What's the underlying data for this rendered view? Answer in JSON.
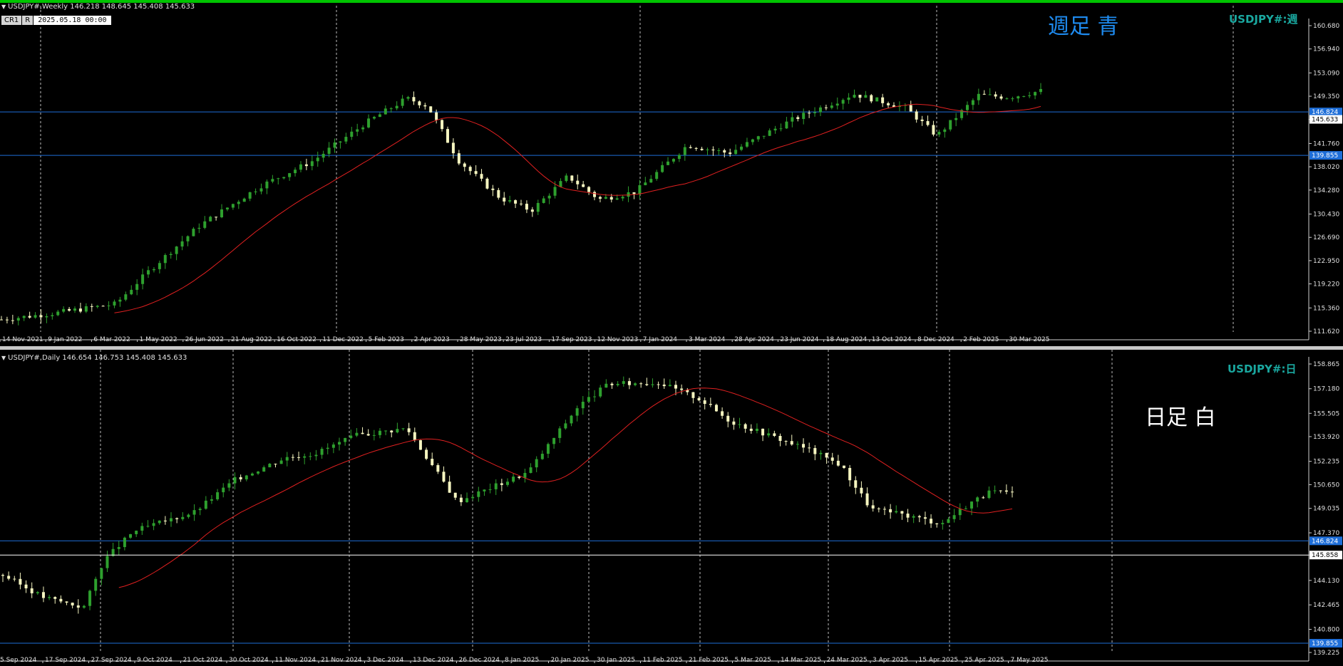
{
  "colors": {
    "background": "#000000",
    "grid": "#cfcfcf",
    "up": "#2ea02e",
    "down": "#f5f5c0",
    "ma": "#e02020",
    "zigzag": "#f0b000",
    "hline": "#1e6ed8",
    "price_tag": "#1e6ed8",
    "symbol_label": "#1aa8a0",
    "weekly_note": "#1e8bf0",
    "daily_note": "#ffffff"
  },
  "weekly": {
    "header": "USDJPY#,Weekly  146.218 148.645 145.408 145.633",
    "toolbar": {
      "btn1": "CR1",
      "btn2": "R",
      "date": "2025.05.18 00:00"
    },
    "note": "週足  青",
    "symbol_label": "USDJPY#:週",
    "yticks": [
      "160.680",
      "156.940",
      "153.090",
      "149.350",
      "145.633",
      "141.760",
      "138.020",
      "134.280",
      "130.430",
      "126.690",
      "122.950",
      "119.220",
      "115.360",
      "111.620"
    ],
    "xticks": [
      "14 Nov 2021",
      "9 Jan 2022",
      "6 Mar 2022",
      "1 May 2022",
      "26 Jun 2022",
      "21 Aug 2022",
      "16 Oct 2022",
      "11 Dec 2022",
      "5 Feb 2023",
      "2 Apr 2023",
      "28 May 2023",
      "23 Jul 2023",
      "17 Sep 2023",
      "12 Nov 2023",
      "7 Jan 2024",
      "3 Mar 2024",
      "28 Apr 2024",
      "23 Jun 2024",
      "18 Aug 2024",
      "13 Oct 2024",
      "8 Dec 2024",
      "2 Feb 2025",
      "30 Mar 2025"
    ],
    "hlines": [
      "146.824",
      "139.855"
    ],
    "current": "145.633"
  },
  "daily": {
    "header": "USDJPY#,Daily  146.654 146.753 145.408 145.633",
    "note": "日足  白",
    "symbol_label": "USDJPY#:日",
    "yticks": [
      "158.865",
      "157.180",
      "155.505",
      "153.920",
      "152.235",
      "150.650",
      "149.035",
      "147.370",
      "145.858",
      "144.130",
      "142.465",
      "140.800",
      "139.225"
    ],
    "xticks": [
      "17 Sep 2024",
      "27 Sep 2024",
      "9 Oct 2024",
      "21 Oct 2024",
      "30 Oct 2024",
      "11 Nov 2024",
      "21 Nov 2024",
      "3 Dec 2024",
      "13 Dec 2024",
      "26 Dec 2024",
      "8 Jan 2025",
      "20 Jan 2025",
      "30 Jan 2025",
      "11 Feb 2025",
      "21 Feb 2025",
      "5 Mar 2025",
      "14 Mar 2025",
      "24 Mar 2025",
      "3 Apr 2025",
      "15 Apr 2025",
      "25 Apr 2025",
      "7 May 2025"
    ],
    "xtick_first": "5 Sep 2024",
    "date_labels": [
      "2024/9/5",
      "9/17",
      "9/27",
      "10/9",
      "10/21",
      "10/30",
      "11/11",
      "11/21",
      "12/3",
      "12/13",
      "12/26",
      "1/8",
      "1/20",
      "1/30",
      "2/11",
      "2/21",
      "3/5",
      "3/14",
      "3/24",
      "4/3",
      "4/15",
      "4/25",
      "5/7"
    ],
    "hlines": [
      "146.824",
      "139.855"
    ],
    "current": "145.858"
  }
}
